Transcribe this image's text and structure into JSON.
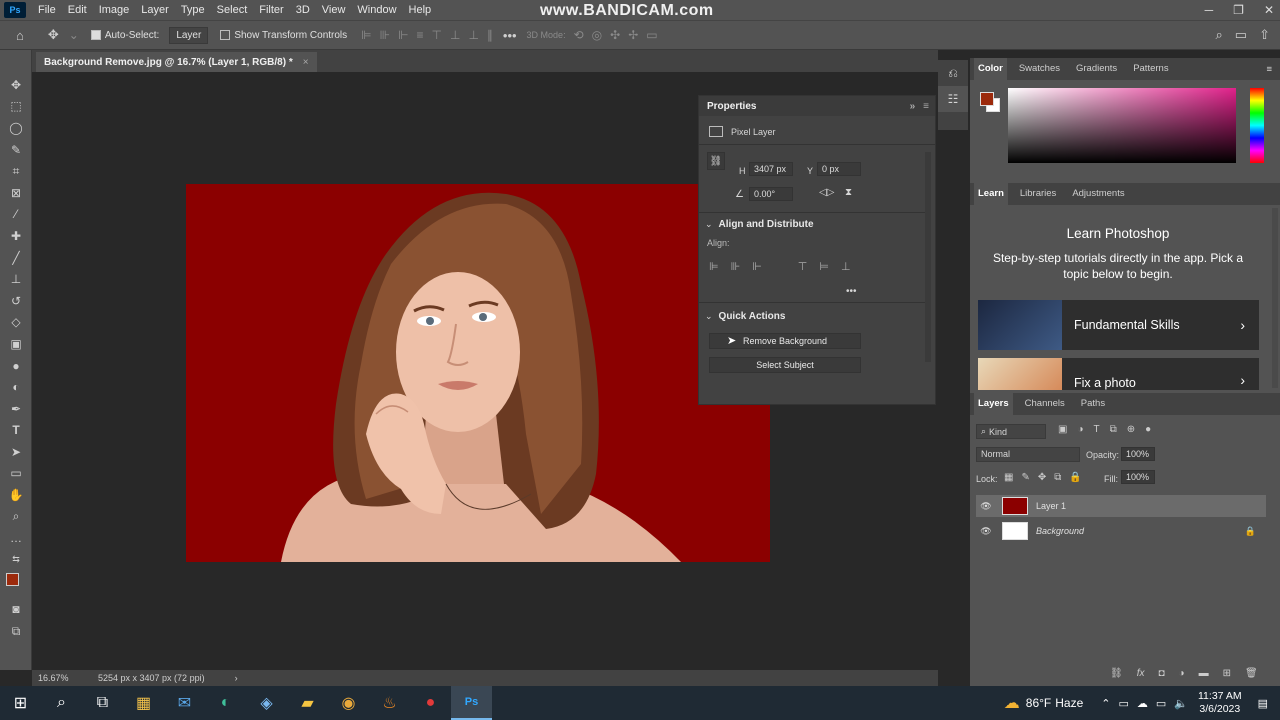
{
  "app": {
    "menu": [
      "File",
      "Edit",
      "Image",
      "Layer",
      "Type",
      "Select",
      "Filter",
      "3D",
      "View",
      "Window",
      "Help"
    ],
    "watermark": "www.BANDICAM.com"
  },
  "options_bar": {
    "auto_select_label": "Auto-Select:",
    "auto_select_value": "Layer",
    "show_transform_label": "Show Transform Controls",
    "mode_3d_label": "3D Mode:",
    "dots": "•••"
  },
  "document": {
    "tab_title": "Background Remove.jpg @ 16.7% (Layer 1, RGB/8) *",
    "zoom": "16.67%",
    "doc_info": "5254 px x 3407 px (72 ppi)"
  },
  "properties": {
    "title": "Properties",
    "layer_type": "Pixel Layer",
    "h_label": "H",
    "h_value": "3407 px",
    "y_label": "Y",
    "y_value": "0 px",
    "angle_value": "0.00°",
    "align_section": "Align and Distribute",
    "align_label": "Align:",
    "more_dots": "•••",
    "quick_actions_section": "Quick Actions",
    "remove_bg_button": "Remove Background",
    "select_subject_button": "Select Subject"
  },
  "color_panel": {
    "tabs": [
      "Color",
      "Swatches",
      "Gradients",
      "Patterns"
    ],
    "foreground": "#9c2a0c",
    "background": "#ffffff"
  },
  "learn_panel": {
    "tabs": [
      "Learn",
      "Libraries",
      "Adjustments"
    ],
    "title": "Learn Photoshop",
    "description": "Step-by-step tutorials directly in the app. Pick a topic below to begin.",
    "cards": [
      "Fundamental Skills",
      "Fix a photo"
    ]
  },
  "layers_panel": {
    "tabs": [
      "Layers",
      "Channels",
      "Paths"
    ],
    "kind_label": "Kind",
    "blend_mode": "Normal",
    "opacity_label": "Opacity:",
    "opacity_value": "100%",
    "lock_label": "Lock:",
    "fill_label": "Fill:",
    "fill_value": "100%",
    "layers": [
      {
        "name": "Layer 1",
        "selected": true
      },
      {
        "name": "Background",
        "selected": false
      }
    ]
  },
  "taskbar": {
    "weather_temp": "86°F",
    "weather_text": "Haze",
    "time": "11:37 AM",
    "date": "3/6/2023"
  },
  "colors": {
    "canvas_bg": "#8b0000",
    "panel": "#535353",
    "workspace": "#282828"
  }
}
